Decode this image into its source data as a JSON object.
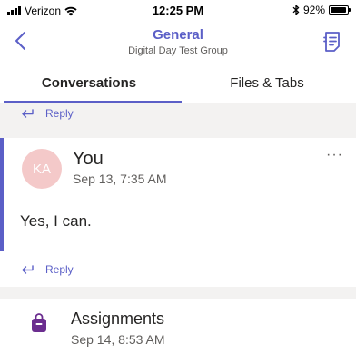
{
  "status_bar": {
    "carrier": "Verizon",
    "time": "12:25 PM",
    "battery": "92%",
    "battery_level": 0.92,
    "icons": [
      "signal-icon",
      "wifi-icon",
      "bluetooth-icon",
      "battery-icon"
    ]
  },
  "header": {
    "title": "General",
    "subtitle": "Digital Day Test Group",
    "icons": [
      "back-chevron-icon",
      "channel-details-icon"
    ],
    "accent_color": "#5b5fc7"
  },
  "tabs": [
    {
      "label": "Conversations",
      "active": true
    },
    {
      "label": "Files & Tabs",
      "active": false
    }
  ],
  "feed": {
    "reply_label": "Reply",
    "message": {
      "avatar_initials": "KA",
      "avatar_color": "#f4c9c9",
      "author": "You",
      "timestamp": "Sep 13, 7:35 AM",
      "more": "···",
      "body": "Yes, I can."
    },
    "next_message": {
      "author": "Assignments",
      "timestamp": "Sep 14, 8:53 AM",
      "icon": "assignments-bag-icon",
      "icon_color": "#6b2d8f"
    }
  }
}
